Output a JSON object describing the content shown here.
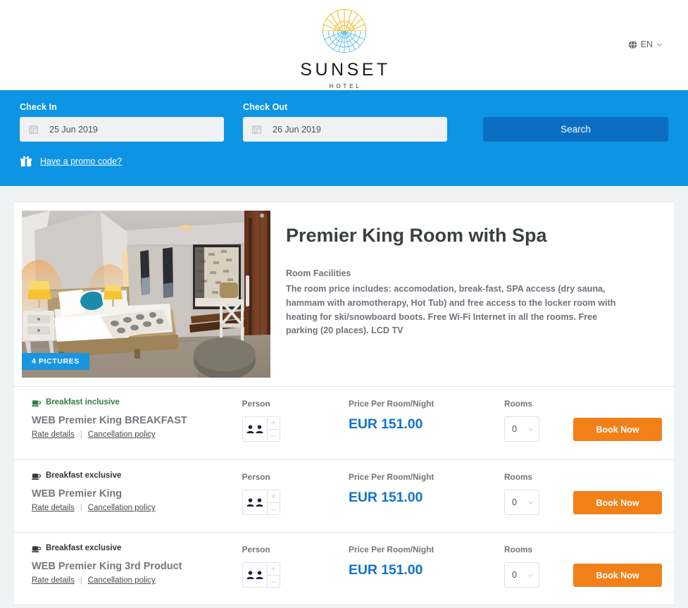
{
  "header": {
    "logo_word": "SUNSET",
    "logo_sub": "HOTEL",
    "logo_icon": "sunset-circle-logo",
    "language": {
      "icon": "globe-icon",
      "label": "EN",
      "chevron": "chevron-down-icon"
    }
  },
  "search": {
    "checkin": {
      "label": "Check In",
      "value": "25 Jun 2019",
      "icon": "calendar-icon"
    },
    "checkout": {
      "label": "Check Out",
      "value": "26 Jun 2019",
      "icon": "calendar-icon"
    },
    "search_button": "Search",
    "promo": {
      "icon": "gift-icon",
      "label": "Have a promo code?"
    },
    "band_color": "#0d94e4",
    "button_color": "#0b6ec2"
  },
  "room": {
    "title": "Premier King Room with Spa",
    "facilities_label": "Room Facilities",
    "facilities_text": "The room price includes: accomodation, break-fast, SPA access (dry sauna, hammam with aromotherapy, Hot Tub) and free access to the locker room with heating for ski/snowboard boots. Free Wi-Fi Internet in all the rooms. Free parking (20 places). LCD TV",
    "pictures_badge": "4 PICTURES",
    "photo_alt": "hotel-room-photo"
  },
  "columns": {
    "person": "Person",
    "price": "Price Per Room/Night",
    "rooms": "Rooms"
  },
  "labels": {
    "rate_details": "Rate details",
    "cancellation_policy": "Cancellation policy",
    "separator": "|",
    "book_now": "Book Now",
    "plus": "+",
    "minus": "–"
  },
  "rates": [
    {
      "meal": "Breakfast inclusive",
      "meal_type": "inclusive",
      "meal_icon": "coffee-cup-icon",
      "name": "WEB Premier King BREAKFAST",
      "persons": 2,
      "price": "EUR 151.00",
      "rooms_selected": "0"
    },
    {
      "meal": "Breakfast exclusive",
      "meal_type": "exclusive",
      "meal_icon": "coffee-cup-icon",
      "name": "WEB Premier King",
      "persons": 2,
      "price": "EUR 151.00",
      "rooms_selected": "0"
    },
    {
      "meal": "Breakfast exclusive",
      "meal_type": "exclusive",
      "meal_icon": "coffee-cup-icon",
      "name": "WEB Premier King 3rd Product",
      "persons": 2,
      "price": "EUR 151.00",
      "rooms_selected": "0"
    }
  ],
  "colors": {
    "accent_blue": "#0d94e4",
    "price_blue": "#1473cc",
    "book_orange": "#f28019",
    "inclusive_green": "#2f7d3f",
    "page_bg": "#f1f2f4"
  }
}
